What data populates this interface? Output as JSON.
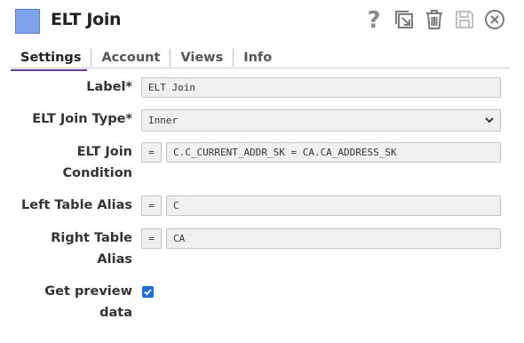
{
  "header": {
    "title": "ELT Join",
    "swatch_color": "#7fa3e8",
    "icons": [
      "help-icon",
      "export-icon",
      "trash-icon",
      "save-icon",
      "close-icon"
    ]
  },
  "tabs": [
    {
      "label": "Settings",
      "active": true
    },
    {
      "label": "Account",
      "active": false
    },
    {
      "label": "Views",
      "active": false
    },
    {
      "label": "Info",
      "active": false
    }
  ],
  "form": {
    "label": {
      "label": "Label*",
      "value": "ELT Join"
    },
    "join_type": {
      "label": "ELT Join Type*",
      "value": "Inner"
    },
    "join_condition": {
      "label_line1": "ELT Join",
      "label_line2": "Condition",
      "expr_button": "=",
      "value": "C.C_CURRENT_ADDR_SK = CA.CA_ADDRESS_SK"
    },
    "left_alias": {
      "label": "Left Table Alias",
      "expr_button": "=",
      "value": "C"
    },
    "right_alias": {
      "label_line1": "Right Table",
      "label_line2": "Alias",
      "expr_button": "=",
      "value": "CA"
    },
    "preview": {
      "label_line1": "Get preview",
      "label_line2": "data",
      "checked": true
    }
  },
  "colors": {
    "accent": "#6a3ca0",
    "checkbox": "#1a6fd6"
  }
}
